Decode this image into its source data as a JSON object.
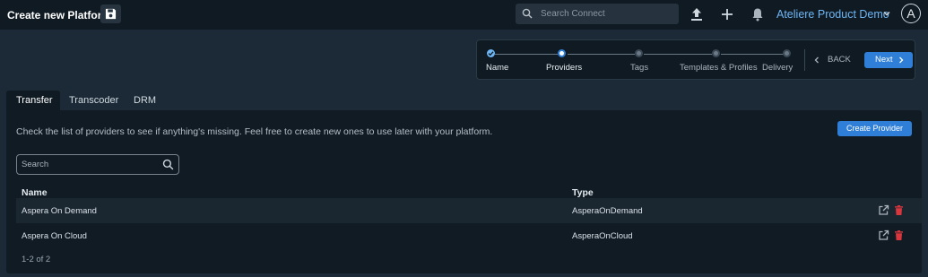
{
  "header": {
    "title": "Create new Platform",
    "search_placeholder": "Search Connect",
    "org_name": "Ateliere Product Demo",
    "avatar_initial": "A"
  },
  "stepper": {
    "steps": [
      {
        "label": "Name",
        "state": "done"
      },
      {
        "label": "Providers",
        "state": "current"
      },
      {
        "label": "Tags",
        "state": "pending"
      },
      {
        "label": "Templates & Profiles",
        "state": "pending"
      },
      {
        "label": "Delivery",
        "state": "pending"
      }
    ],
    "back_label": "BACK",
    "next_label": "Next"
  },
  "tabs": [
    {
      "label": "Transfer",
      "active": true
    },
    {
      "label": "Transcoder",
      "active": false
    },
    {
      "label": "DRM",
      "active": false
    }
  ],
  "panel": {
    "description": "Check the list of providers to see if anything's missing. Feel free to create new ones to use later with your platform.",
    "create_label": "Create Provider",
    "search_placeholder": "Search"
  },
  "table": {
    "columns": [
      "Name",
      "Type"
    ],
    "rows": [
      {
        "name": "Aspera On Demand",
        "type": "AsperaOnDemand"
      },
      {
        "name": "Aspera On Cloud",
        "type": "AsperaOnCloud"
      }
    ],
    "pagination": "1-2 of 2"
  },
  "colors": {
    "accent": "#2f7fd8",
    "link": "#6fb6f4",
    "delete": "#d9363e",
    "background": "#1b2a36",
    "panel": "#101b24"
  }
}
